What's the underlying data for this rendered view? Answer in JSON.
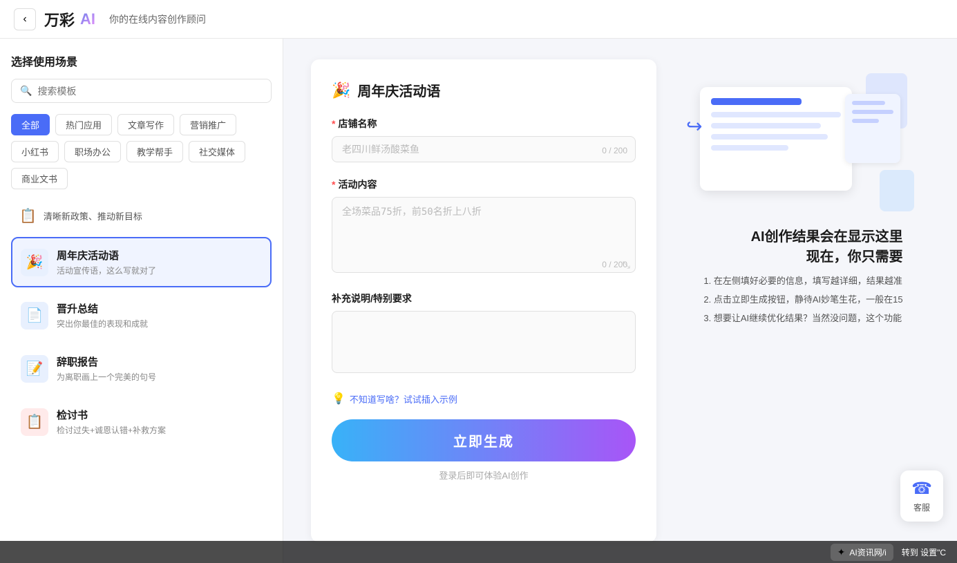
{
  "header": {
    "back_label": "‹",
    "logo_main": "万彩",
    "logo_ai": "AI",
    "subtitle": "你的在线内容创作顾问"
  },
  "sidebar": {
    "title": "选择使用场景",
    "search_placeholder": "搜索模板",
    "categories": [
      {
        "label": "全部",
        "active": true
      },
      {
        "label": "热门应用",
        "active": false
      },
      {
        "label": "文章写作",
        "active": false
      },
      {
        "label": "营销推广",
        "active": false
      },
      {
        "label": "小红书",
        "active": false
      },
      {
        "label": "职场办公",
        "active": false
      },
      {
        "label": "教学帮手",
        "active": false
      },
      {
        "label": "社交媒体",
        "active": false
      },
      {
        "label": "商业文书",
        "active": false
      }
    ],
    "featured": {
      "icon": "📋",
      "text": "清晰新政策、推动新目标"
    },
    "items": [
      {
        "icon": "🎉",
        "icon_bg": "blue",
        "title": "周年庆活动语",
        "desc": "活动宣传语，这么写就对了",
        "active": true
      },
      {
        "icon": "📄",
        "icon_bg": "blue",
        "title": "晋升总结",
        "desc": "突出你最佳的表现和成就",
        "active": false
      },
      {
        "icon": "📝",
        "icon_bg": "blue",
        "title": "辞职报告",
        "desc": "为离职画上一个完美的句号",
        "active": false
      },
      {
        "icon": "📋",
        "icon_bg": "red",
        "title": "检讨书",
        "desc": "检讨过失+诚恩认错+补救方案",
        "active": false
      }
    ]
  },
  "form": {
    "title": "周年庆活动语",
    "title_icon": "🎉",
    "fields": [
      {
        "id": "shop_name",
        "label": "店铺名称",
        "required": true,
        "placeholder": "老四川鲜汤酸菜鱼",
        "max": 200,
        "current": 0,
        "type": "input"
      },
      {
        "id": "activity_content",
        "label": "活动内容",
        "required": true,
        "placeholder": "全场菜品75折，前50名折上八折",
        "max": 200,
        "current": 0,
        "type": "textarea"
      },
      {
        "id": "extra_notes",
        "label": "补充说明/特别要求",
        "required": false,
        "placeholder": "",
        "max": null,
        "current": null,
        "type": "textarea_sm"
      }
    ],
    "hint_icon": "💡",
    "hint_text": "不知道写啥？试试插入示例",
    "generate_label": "立即生成",
    "login_hint": "登录后即可体验AI创作"
  },
  "right_panel": {
    "ai_title": "AI创作结果会在显示这里",
    "ai_subtitle": "现在，你只需要",
    "steps": [
      "1. 在左侧填好必要的信息，填写越详细，结果越准",
      "2. 点击立即生成按钮，静待AI妙笔生花，一般在15",
      "3. 想要让AI继续优化结果？当然没问题，这个功能"
    ]
  },
  "customer_service": {
    "icon": "☎",
    "label": "客服"
  },
  "bottom_bar": {
    "logo_icon": "✦",
    "logo_text": "AI资讯网/i",
    "action_text": "转到 设置\"C"
  }
}
